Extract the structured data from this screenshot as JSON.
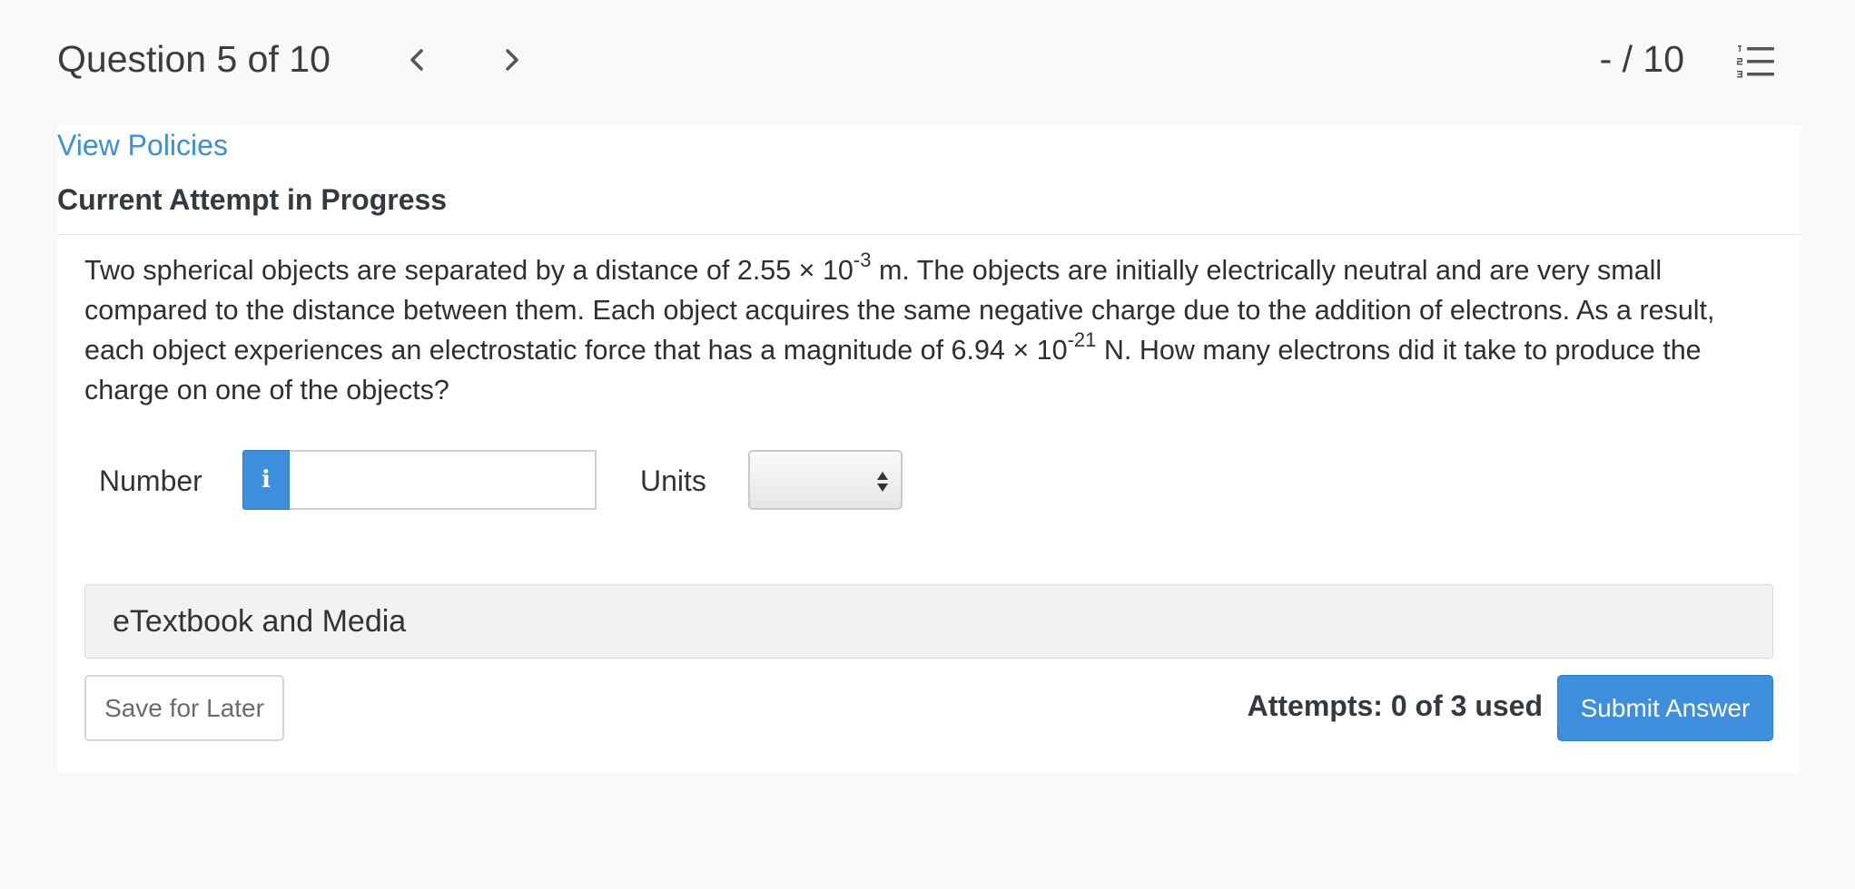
{
  "header": {
    "title": "Question 5 of 10",
    "score": "- / 10",
    "icons": {
      "prev": "chevron-left-icon",
      "next": "chevron-right-icon",
      "list": "numbered-list-icon"
    }
  },
  "card": {
    "policies_link": "View Policies",
    "attempt_heading": "Current Attempt in Progress"
  },
  "question": {
    "part1": "Two spherical objects are separated by a distance of 2.55 × 10",
    "exp1": "-3",
    "part2": " m. The objects are initially electrically neutral and are very small compared to the distance between them. Each object acquires the same negative charge due to the addition of electrons. As a result, each object experiences an electrostatic force that has a magnitude of 6.94 × 10",
    "exp2": "-21",
    "part3": " N. How many electrons did it take to produce the charge on one of the objects?"
  },
  "answer": {
    "number_label": "Number",
    "info_glyph": "i",
    "number_value": "",
    "units_label": "Units",
    "units_selected": ""
  },
  "media": {
    "label": "eTextbook and Media"
  },
  "footer": {
    "save_label": "Save for Later",
    "attempts_text": "Attempts: 0 of 3 used",
    "submit_label": "Submit Answer"
  },
  "colors": {
    "accent": "#3d8fdd",
    "link": "#3d8fd6",
    "page_bg": "#f8f8f8",
    "card_bg": "#ffffff"
  }
}
